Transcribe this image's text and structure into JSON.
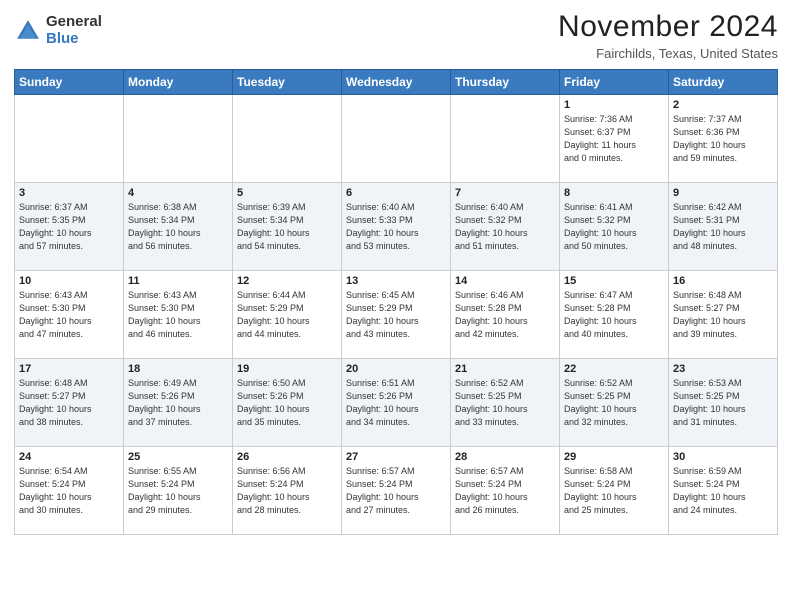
{
  "header": {
    "logo": {
      "general": "General",
      "blue": "Blue"
    },
    "title": "November 2024",
    "location": "Fairchilds, Texas, United States"
  },
  "weekdays": [
    "Sunday",
    "Monday",
    "Tuesday",
    "Wednesday",
    "Thursday",
    "Friday",
    "Saturday"
  ],
  "weeks": [
    [
      {
        "day": "",
        "info": ""
      },
      {
        "day": "",
        "info": ""
      },
      {
        "day": "",
        "info": ""
      },
      {
        "day": "",
        "info": ""
      },
      {
        "day": "",
        "info": ""
      },
      {
        "day": "1",
        "info": "Sunrise: 7:36 AM\nSunset: 6:37 PM\nDaylight: 11 hours\nand 0 minutes."
      },
      {
        "day": "2",
        "info": "Sunrise: 7:37 AM\nSunset: 6:36 PM\nDaylight: 10 hours\nand 59 minutes."
      }
    ],
    [
      {
        "day": "3",
        "info": "Sunrise: 6:37 AM\nSunset: 5:35 PM\nDaylight: 10 hours\nand 57 minutes."
      },
      {
        "day": "4",
        "info": "Sunrise: 6:38 AM\nSunset: 5:34 PM\nDaylight: 10 hours\nand 56 minutes."
      },
      {
        "day": "5",
        "info": "Sunrise: 6:39 AM\nSunset: 5:34 PM\nDaylight: 10 hours\nand 54 minutes."
      },
      {
        "day": "6",
        "info": "Sunrise: 6:40 AM\nSunset: 5:33 PM\nDaylight: 10 hours\nand 53 minutes."
      },
      {
        "day": "7",
        "info": "Sunrise: 6:40 AM\nSunset: 5:32 PM\nDaylight: 10 hours\nand 51 minutes."
      },
      {
        "day": "8",
        "info": "Sunrise: 6:41 AM\nSunset: 5:32 PM\nDaylight: 10 hours\nand 50 minutes."
      },
      {
        "day": "9",
        "info": "Sunrise: 6:42 AM\nSunset: 5:31 PM\nDaylight: 10 hours\nand 48 minutes."
      }
    ],
    [
      {
        "day": "10",
        "info": "Sunrise: 6:43 AM\nSunset: 5:30 PM\nDaylight: 10 hours\nand 47 minutes."
      },
      {
        "day": "11",
        "info": "Sunrise: 6:43 AM\nSunset: 5:30 PM\nDaylight: 10 hours\nand 46 minutes."
      },
      {
        "day": "12",
        "info": "Sunrise: 6:44 AM\nSunset: 5:29 PM\nDaylight: 10 hours\nand 44 minutes."
      },
      {
        "day": "13",
        "info": "Sunrise: 6:45 AM\nSunset: 5:29 PM\nDaylight: 10 hours\nand 43 minutes."
      },
      {
        "day": "14",
        "info": "Sunrise: 6:46 AM\nSunset: 5:28 PM\nDaylight: 10 hours\nand 42 minutes."
      },
      {
        "day": "15",
        "info": "Sunrise: 6:47 AM\nSunset: 5:28 PM\nDaylight: 10 hours\nand 40 minutes."
      },
      {
        "day": "16",
        "info": "Sunrise: 6:48 AM\nSunset: 5:27 PM\nDaylight: 10 hours\nand 39 minutes."
      }
    ],
    [
      {
        "day": "17",
        "info": "Sunrise: 6:48 AM\nSunset: 5:27 PM\nDaylight: 10 hours\nand 38 minutes."
      },
      {
        "day": "18",
        "info": "Sunrise: 6:49 AM\nSunset: 5:26 PM\nDaylight: 10 hours\nand 37 minutes."
      },
      {
        "day": "19",
        "info": "Sunrise: 6:50 AM\nSunset: 5:26 PM\nDaylight: 10 hours\nand 35 minutes."
      },
      {
        "day": "20",
        "info": "Sunrise: 6:51 AM\nSunset: 5:26 PM\nDaylight: 10 hours\nand 34 minutes."
      },
      {
        "day": "21",
        "info": "Sunrise: 6:52 AM\nSunset: 5:25 PM\nDaylight: 10 hours\nand 33 minutes."
      },
      {
        "day": "22",
        "info": "Sunrise: 6:52 AM\nSunset: 5:25 PM\nDaylight: 10 hours\nand 32 minutes."
      },
      {
        "day": "23",
        "info": "Sunrise: 6:53 AM\nSunset: 5:25 PM\nDaylight: 10 hours\nand 31 minutes."
      }
    ],
    [
      {
        "day": "24",
        "info": "Sunrise: 6:54 AM\nSunset: 5:24 PM\nDaylight: 10 hours\nand 30 minutes."
      },
      {
        "day": "25",
        "info": "Sunrise: 6:55 AM\nSunset: 5:24 PM\nDaylight: 10 hours\nand 29 minutes."
      },
      {
        "day": "26",
        "info": "Sunrise: 6:56 AM\nSunset: 5:24 PM\nDaylight: 10 hours\nand 28 minutes."
      },
      {
        "day": "27",
        "info": "Sunrise: 6:57 AM\nSunset: 5:24 PM\nDaylight: 10 hours\nand 27 minutes."
      },
      {
        "day": "28",
        "info": "Sunrise: 6:57 AM\nSunset: 5:24 PM\nDaylight: 10 hours\nand 26 minutes."
      },
      {
        "day": "29",
        "info": "Sunrise: 6:58 AM\nSunset: 5:24 PM\nDaylight: 10 hours\nand 25 minutes."
      },
      {
        "day": "30",
        "info": "Sunrise: 6:59 AM\nSunset: 5:24 PM\nDaylight: 10 hours\nand 24 minutes."
      }
    ]
  ]
}
